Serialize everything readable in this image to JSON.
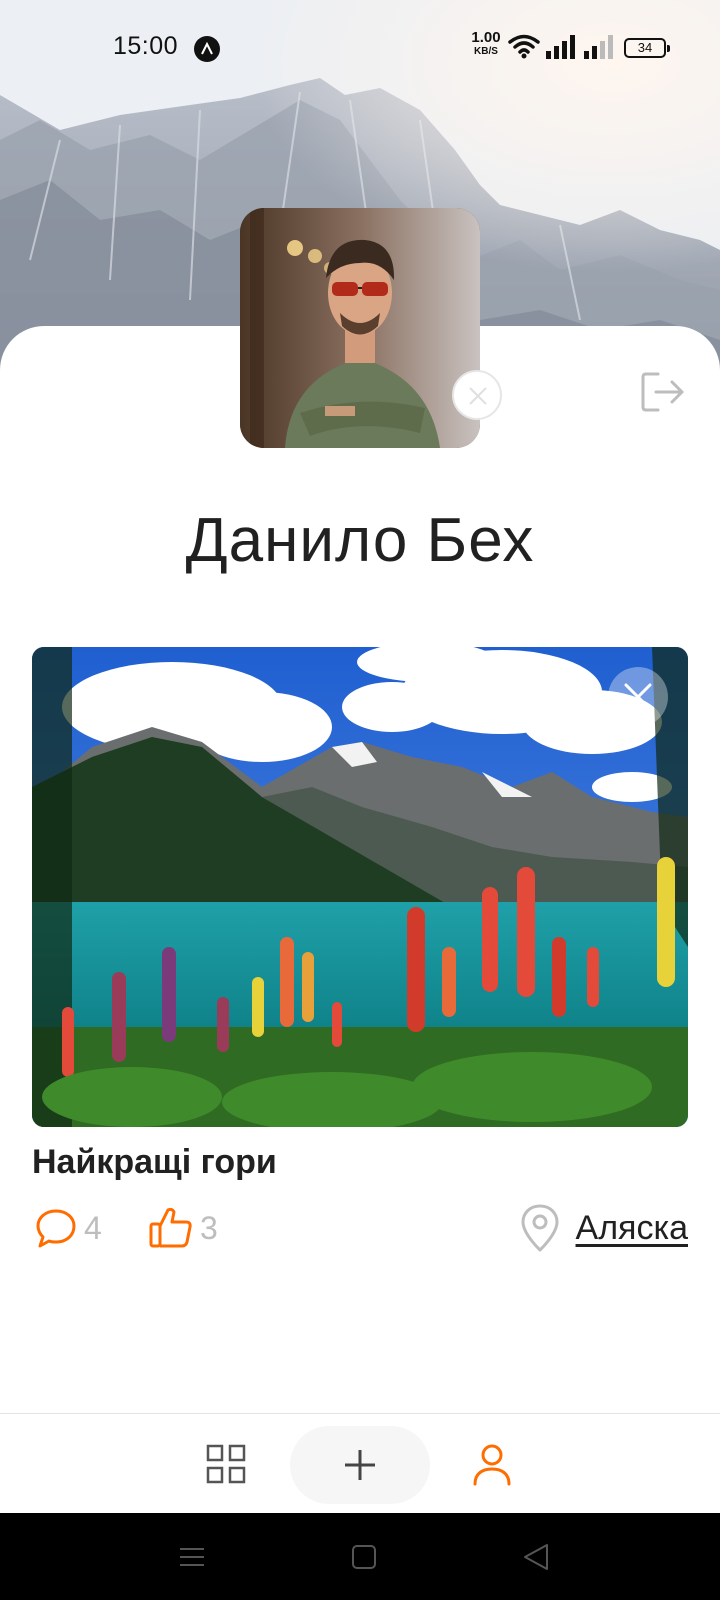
{
  "status_bar": {
    "time": "15:00",
    "network_speed_value": "1.00",
    "network_speed_unit": "KB/S",
    "battery": "34",
    "icons": [
      "app-notification-icon",
      "wifi-icon",
      "signal-icon",
      "signal-icon",
      "battery-icon"
    ]
  },
  "profile": {
    "name": "Данило Бех",
    "avatar_icon": "user-photo",
    "remove_avatar_icon": "close-circle-icon",
    "logout_icon": "logout-icon"
  },
  "post": {
    "title": "Найкращі гори",
    "comments_count": "4",
    "likes_count": "3",
    "location": "Аляска",
    "icons": {
      "comments": "comment-icon",
      "likes": "thumbs-up-icon",
      "location": "map-pin-icon",
      "delete": "close-icon"
    }
  },
  "tab_bar": {
    "items": [
      {
        "name": "posts",
        "icon": "grid-icon"
      },
      {
        "name": "create",
        "icon": "plus-icon"
      },
      {
        "name": "profile",
        "icon": "user-icon",
        "active": true
      }
    ]
  },
  "system_nav": {
    "icons": [
      "menu-icon",
      "home-icon",
      "back-icon"
    ]
  },
  "colors": {
    "accent": "#FF6C00",
    "text": "#212121",
    "muted": "#BDBDBD",
    "tab_add_bg": "#F6F6F6"
  }
}
